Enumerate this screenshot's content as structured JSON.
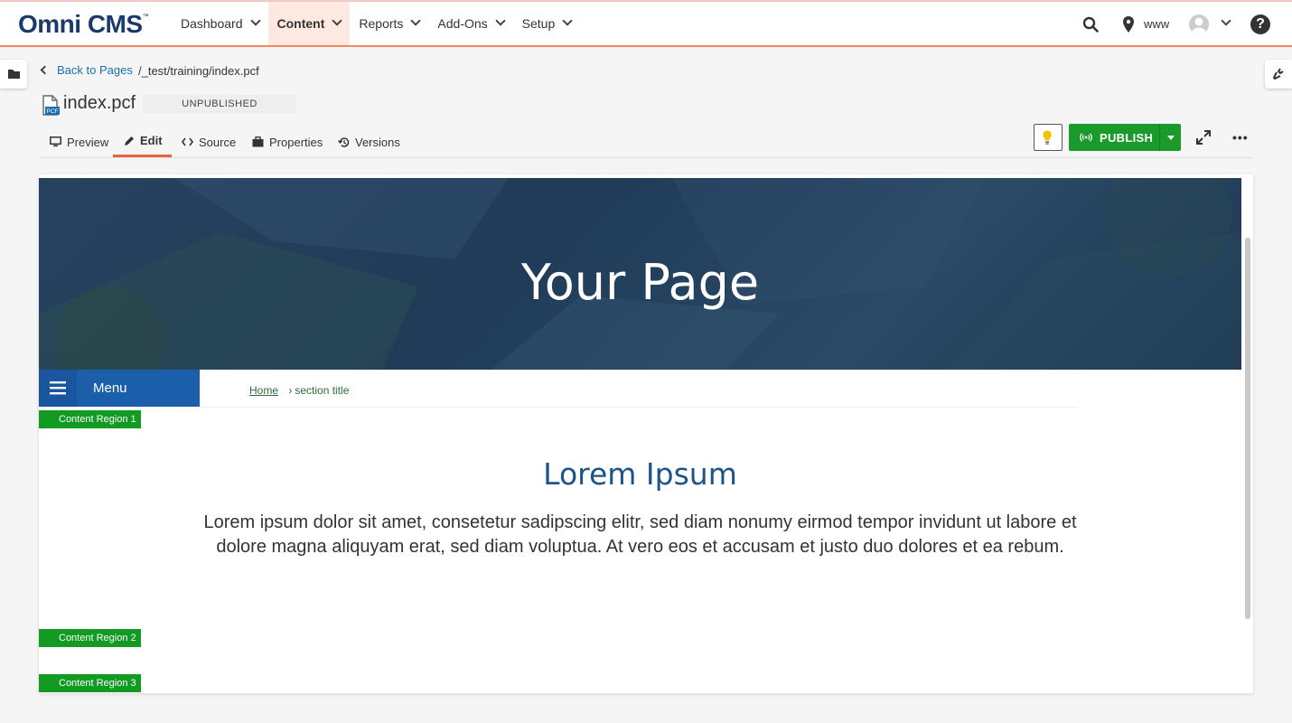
{
  "app": {
    "logo": "Omni CMS",
    "logo_mark": "™"
  },
  "nav": {
    "items": [
      {
        "label": "Dashboard",
        "active": false
      },
      {
        "label": "Content",
        "active": true
      },
      {
        "label": "Reports",
        "active": false
      },
      {
        "label": "Add-Ons",
        "active": false
      },
      {
        "label": "Setup",
        "active": false
      }
    ],
    "site": "www",
    "help_glyph": "?"
  },
  "breadcrumb": {
    "back_label": "Back to Pages",
    "path": "/_test/training/index.pcf"
  },
  "file": {
    "name": "index.pcf",
    "icon_tag": "PCF",
    "status": "UNPUBLISHED"
  },
  "tabs": [
    {
      "label": "Preview",
      "icon": "monitor-icon",
      "active": false
    },
    {
      "label": "Edit",
      "icon": "pencil-icon",
      "active": true
    },
    {
      "label": "Source",
      "icon": "code-icon",
      "active": false
    },
    {
      "label": "Properties",
      "icon": "briefcase-icon",
      "active": false
    },
    {
      "label": "Versions",
      "icon": "history-icon",
      "active": false
    }
  ],
  "toolbar": {
    "publish_label": "PUBLISH",
    "more_label": "•••"
  },
  "page": {
    "hero_title": "Your Page",
    "menu_label": "Menu",
    "crumb_home": "Home",
    "crumb_sep": "›",
    "crumb_section": "section title",
    "regions": [
      "Content Region 1",
      "Content Region 2",
      "Content Region 3"
    ],
    "heading": "Lorem Ipsum",
    "body": "Lorem ipsum dolor sit amet, consetetur sadipscing elitr, sed diam nonumy eirmod tempor invidunt ut labore et dolore magna aliquyam erat, sed diam voluptua. At vero eos et accusam et justo duo dolores et ea rebum."
  },
  "colors": {
    "accent": "#e8623a",
    "publish": "#1a9a2a",
    "brand": "#1b3a6b",
    "region": "#129a22",
    "menu": "#1b5faa"
  }
}
